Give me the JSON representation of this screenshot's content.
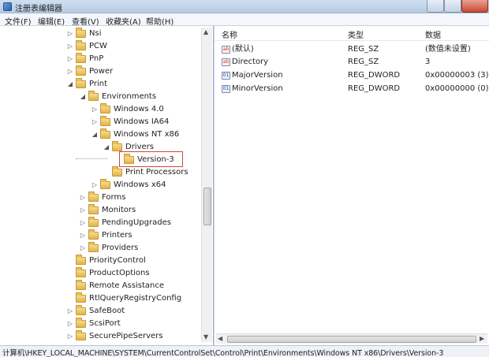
{
  "window": {
    "title": "注册表编辑器"
  },
  "menu": [
    {
      "id": "file",
      "label": "文件(F)"
    },
    {
      "id": "edit",
      "label": "编辑(E)"
    },
    {
      "id": "view",
      "label": "查看(V)"
    },
    {
      "id": "favorites",
      "label": "收藏夹(A)"
    },
    {
      "id": "help",
      "label": "帮助(H)"
    }
  ],
  "tree": {
    "nodes": [
      {
        "label": "Nsi",
        "arrow": "▷"
      },
      {
        "label": "PCW",
        "arrow": "▷"
      },
      {
        "label": "PnP",
        "arrow": "▷"
      },
      {
        "label": "Power",
        "arrow": "▷"
      },
      {
        "label": "Print",
        "arrow": "◢"
      },
      {
        "label": "Environments",
        "arrow": "◢"
      },
      {
        "label": "Windows 4.0",
        "arrow": "▷"
      },
      {
        "label": "Windows IA64",
        "arrow": "▷"
      },
      {
        "label": "Windows NT x86",
        "arrow": "◢"
      },
      {
        "label": "Drivers",
        "arrow": "◢"
      },
      {
        "label": "Version-3",
        "arrow": "",
        "selected": true
      },
      {
        "label": "Print Processors",
        "arrow": ""
      },
      {
        "label": "Windows x64",
        "arrow": "▷"
      },
      {
        "label": "Forms",
        "arrow": "▷"
      },
      {
        "label": "Monitors",
        "arrow": "▷"
      },
      {
        "label": "PendingUpgrades",
        "arrow": "▷"
      },
      {
        "label": "Printers",
        "arrow": "▷"
      },
      {
        "label": "Providers",
        "arrow": "▷"
      },
      {
        "label": "PriorityControl",
        "arrow": ""
      },
      {
        "label": "ProductOptions",
        "arrow": ""
      },
      {
        "label": "Remote Assistance",
        "arrow": ""
      },
      {
        "label": "RtlQueryRegistryConfig",
        "arrow": ""
      },
      {
        "label": "SafeBoot",
        "arrow": "▷"
      },
      {
        "label": "ScsiPort",
        "arrow": "▷"
      },
      {
        "label": "SecurePipeServers",
        "arrow": "▷"
      }
    ]
  },
  "list": {
    "columns": {
      "name": "名称",
      "type": "类型",
      "data": "数据"
    },
    "rows": [
      {
        "icon": "string-value-icon",
        "glyph": "ab",
        "name": "(默认)",
        "type": "REG_SZ",
        "data": "(数值未设置)"
      },
      {
        "icon": "string-value-icon",
        "glyph": "ab",
        "name": "Directory",
        "type": "REG_SZ",
        "data": "3"
      },
      {
        "icon": "dword-value-icon",
        "glyph": "01",
        "name": "MajorVersion",
        "type": "REG_DWORD",
        "data": "0x00000003 (3)"
      },
      {
        "icon": "dword-value-icon",
        "glyph": "01",
        "name": "MinorVersion",
        "type": "REG_DWORD",
        "data": "0x00000000 (0)"
      }
    ]
  },
  "status": {
    "path": "计算机\\HKEY_LOCAL_MACHINE\\SYSTEM\\CurrentControlSet\\Control\\Print\\Environments\\Windows NT x86\\Drivers\\Version-3"
  }
}
